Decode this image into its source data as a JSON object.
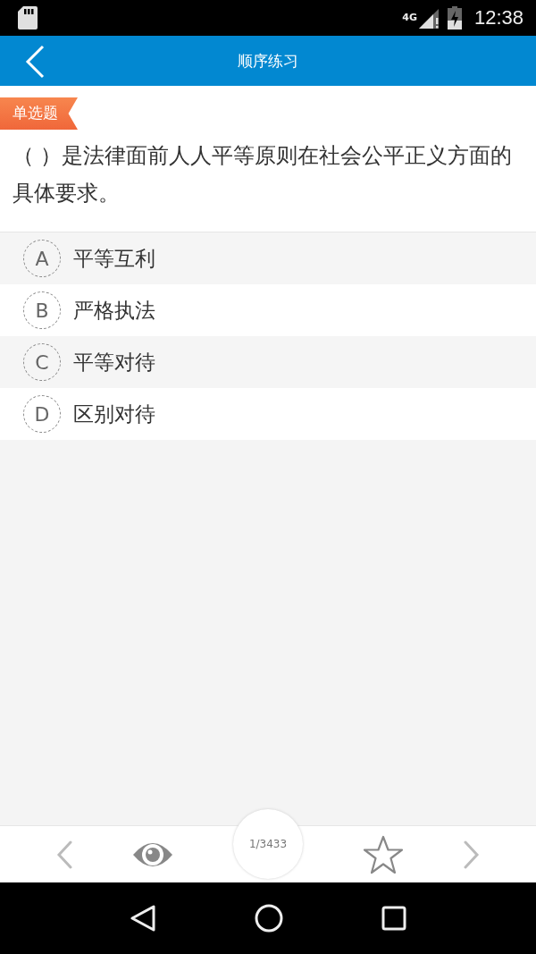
{
  "status_bar": {
    "network": "4G",
    "time": "12:38"
  },
  "app_bar": {
    "title": "顺序练习"
  },
  "question": {
    "type_badge": "单选题",
    "text": "（ ）是法律面前人人平等原则在社会公平正义方面的具体要求。"
  },
  "options": [
    {
      "letter": "A",
      "text": "平等互利"
    },
    {
      "letter": "B",
      "text": "严格执法"
    },
    {
      "letter": "C",
      "text": "平等对待"
    },
    {
      "letter": "D",
      "text": "区别对待"
    }
  ],
  "bottom_bar": {
    "counter": "1/3433"
  }
}
